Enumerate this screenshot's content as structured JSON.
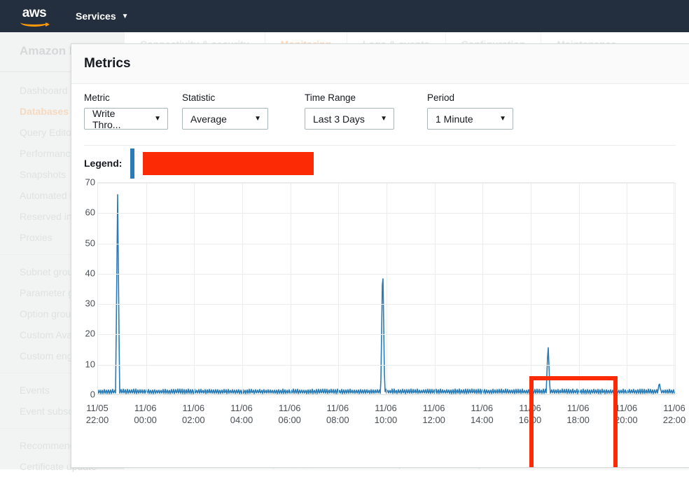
{
  "navbar": {
    "logo_alt": "aws",
    "services_label": "Services",
    "caret": "▼"
  },
  "background": {
    "sidebar_title": "Amazon RDS",
    "nav_groups": [
      {
        "items": [
          {
            "label": "Dashboard",
            "selected": false
          },
          {
            "label": "Databases",
            "selected": true
          },
          {
            "label": "Query Editor",
            "selected": false
          },
          {
            "label": "Performance insights",
            "selected": false
          },
          {
            "label": "Snapshots",
            "selected": false
          },
          {
            "label": "Automated backups",
            "selected": false
          },
          {
            "label": "Reserved instances",
            "selected": false
          },
          {
            "label": "Proxies",
            "selected": false
          }
        ]
      },
      {
        "items": [
          {
            "label": "Subnet groups",
            "selected": false
          },
          {
            "label": "Parameter groups",
            "selected": false
          },
          {
            "label": "Option groups",
            "selected": false
          },
          {
            "label": "Custom Availability Zones",
            "selected": false
          },
          {
            "label": "Custom engine versions",
            "selected": false
          }
        ]
      },
      {
        "items": [
          {
            "label": "Events",
            "selected": false
          },
          {
            "label": "Event subscriptions",
            "selected": false
          }
        ]
      },
      {
        "items": [
          {
            "label": "Recommendations",
            "selected": false
          },
          {
            "label": "Certificate update",
            "selected": false
          }
        ]
      }
    ],
    "tabs": [
      {
        "label": "Connectivity & security",
        "active": false
      },
      {
        "label": "Monitoring",
        "active": true
      },
      {
        "label": "Logs & events",
        "active": false
      },
      {
        "label": "Configuration",
        "active": false
      },
      {
        "label": "Maintenance",
        "active": false
      }
    ],
    "bottom_text": "• • •"
  },
  "modal": {
    "title": "Metrics",
    "controls": [
      {
        "label": "Metric",
        "value": "Write Thro...",
        "caret": "▼"
      },
      {
        "label": "Statistic",
        "value": "Average",
        "caret": "▼"
      },
      {
        "label": "Time Range",
        "value": "Last 3 Days",
        "caret": "▼"
      },
      {
        "label": "Period",
        "value": "1 Minute",
        "caret": "▼"
      }
    ],
    "legend": {
      "label": "Legend:",
      "swatch_color": "#2a7cb8",
      "redaction_color": "#fc2b06",
      "series_name_redacted": ""
    },
    "highlight": {
      "color": "#fc2b06",
      "covers_ticks": [
        "11/06 14:00",
        "11/06 16:00"
      ]
    }
  },
  "chart_data": {
    "type": "line",
    "title": "",
    "xlabel": "",
    "ylabel": "",
    "ylim": [
      0,
      70
    ],
    "yticks": [
      0,
      10,
      20,
      30,
      40,
      50,
      60,
      70
    ],
    "grid": true,
    "legend_position": "above-chart",
    "line_color": "#2a7cb8",
    "xticks": [
      {
        "date": "11/05",
        "time": "22:00"
      },
      {
        "date": "11/06",
        "time": "00:00"
      },
      {
        "date": "11/06",
        "time": "02:00"
      },
      {
        "date": "11/06",
        "time": "04:00"
      },
      {
        "date": "11/06",
        "time": "06:00"
      },
      {
        "date": "11/06",
        "time": "08:00"
      },
      {
        "date": "11/06",
        "time": "10:00"
      },
      {
        "date": "11/06",
        "time": "12:00"
      },
      {
        "date": "11/06",
        "time": "14:00"
      },
      {
        "date": "11/06",
        "time": "16:00"
      },
      {
        "date": "11/06",
        "time": "18:00"
      },
      {
        "date": "11/06",
        "time": "20:00"
      },
      {
        "date": "11/06",
        "time": "22:00"
      }
    ],
    "series": [
      {
        "name": "",
        "baseline_mean": 1.0,
        "baseline_noise_amplitude": 1.0,
        "peaks": [
          {
            "x_label": "11/05 23:00",
            "x_fraction": 0.034,
            "value": 66.5
          },
          {
            "x_label": "11/06 09:45",
            "x_fraction": 0.494,
            "value": 45.2
          },
          {
            "x_label": "11/06 16:25",
            "x_fraction": 0.781,
            "value": 17.0
          },
          {
            "x_label": "11/06 21:30",
            "x_fraction": 0.974,
            "value": 4.2
          }
        ]
      }
    ]
  }
}
